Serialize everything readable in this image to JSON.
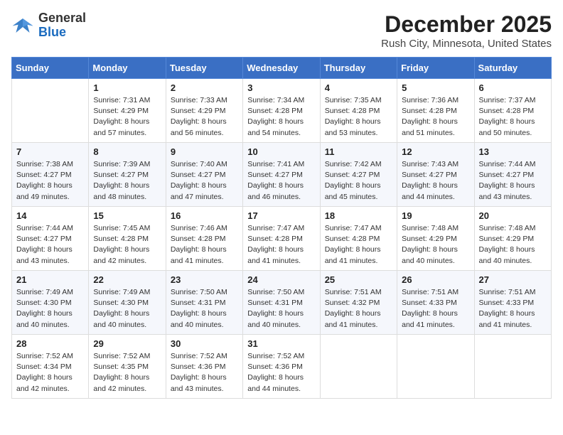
{
  "logo": {
    "general": "General",
    "blue": "Blue"
  },
  "title": "December 2025",
  "subtitle": "Rush City, Minnesota, United States",
  "days_of_week": [
    "Sunday",
    "Monday",
    "Tuesday",
    "Wednesday",
    "Thursday",
    "Friday",
    "Saturday"
  ],
  "weeks": [
    [
      {
        "day": "",
        "info": ""
      },
      {
        "day": "1",
        "info": "Sunrise: 7:31 AM\nSunset: 4:29 PM\nDaylight: 8 hours\nand 57 minutes."
      },
      {
        "day": "2",
        "info": "Sunrise: 7:33 AM\nSunset: 4:29 PM\nDaylight: 8 hours\nand 56 minutes."
      },
      {
        "day": "3",
        "info": "Sunrise: 7:34 AM\nSunset: 4:28 PM\nDaylight: 8 hours\nand 54 minutes."
      },
      {
        "day": "4",
        "info": "Sunrise: 7:35 AM\nSunset: 4:28 PM\nDaylight: 8 hours\nand 53 minutes."
      },
      {
        "day": "5",
        "info": "Sunrise: 7:36 AM\nSunset: 4:28 PM\nDaylight: 8 hours\nand 51 minutes."
      },
      {
        "day": "6",
        "info": "Sunrise: 7:37 AM\nSunset: 4:28 PM\nDaylight: 8 hours\nand 50 minutes."
      }
    ],
    [
      {
        "day": "7",
        "info": "Sunrise: 7:38 AM\nSunset: 4:27 PM\nDaylight: 8 hours\nand 49 minutes."
      },
      {
        "day": "8",
        "info": "Sunrise: 7:39 AM\nSunset: 4:27 PM\nDaylight: 8 hours\nand 48 minutes."
      },
      {
        "day": "9",
        "info": "Sunrise: 7:40 AM\nSunset: 4:27 PM\nDaylight: 8 hours\nand 47 minutes."
      },
      {
        "day": "10",
        "info": "Sunrise: 7:41 AM\nSunset: 4:27 PM\nDaylight: 8 hours\nand 46 minutes."
      },
      {
        "day": "11",
        "info": "Sunrise: 7:42 AM\nSunset: 4:27 PM\nDaylight: 8 hours\nand 45 minutes."
      },
      {
        "day": "12",
        "info": "Sunrise: 7:43 AM\nSunset: 4:27 PM\nDaylight: 8 hours\nand 44 minutes."
      },
      {
        "day": "13",
        "info": "Sunrise: 7:44 AM\nSunset: 4:27 PM\nDaylight: 8 hours\nand 43 minutes."
      }
    ],
    [
      {
        "day": "14",
        "info": "Sunrise: 7:44 AM\nSunset: 4:27 PM\nDaylight: 8 hours\nand 43 minutes."
      },
      {
        "day": "15",
        "info": "Sunrise: 7:45 AM\nSunset: 4:28 PM\nDaylight: 8 hours\nand 42 minutes."
      },
      {
        "day": "16",
        "info": "Sunrise: 7:46 AM\nSunset: 4:28 PM\nDaylight: 8 hours\nand 41 minutes."
      },
      {
        "day": "17",
        "info": "Sunrise: 7:47 AM\nSunset: 4:28 PM\nDaylight: 8 hours\nand 41 minutes."
      },
      {
        "day": "18",
        "info": "Sunrise: 7:47 AM\nSunset: 4:28 PM\nDaylight: 8 hours\nand 41 minutes."
      },
      {
        "day": "19",
        "info": "Sunrise: 7:48 AM\nSunset: 4:29 PM\nDaylight: 8 hours\nand 40 minutes."
      },
      {
        "day": "20",
        "info": "Sunrise: 7:48 AM\nSunset: 4:29 PM\nDaylight: 8 hours\nand 40 minutes."
      }
    ],
    [
      {
        "day": "21",
        "info": "Sunrise: 7:49 AM\nSunset: 4:30 PM\nDaylight: 8 hours\nand 40 minutes."
      },
      {
        "day": "22",
        "info": "Sunrise: 7:49 AM\nSunset: 4:30 PM\nDaylight: 8 hours\nand 40 minutes."
      },
      {
        "day": "23",
        "info": "Sunrise: 7:50 AM\nSunset: 4:31 PM\nDaylight: 8 hours\nand 40 minutes."
      },
      {
        "day": "24",
        "info": "Sunrise: 7:50 AM\nSunset: 4:31 PM\nDaylight: 8 hours\nand 40 minutes."
      },
      {
        "day": "25",
        "info": "Sunrise: 7:51 AM\nSunset: 4:32 PM\nDaylight: 8 hours\nand 41 minutes."
      },
      {
        "day": "26",
        "info": "Sunrise: 7:51 AM\nSunset: 4:33 PM\nDaylight: 8 hours\nand 41 minutes."
      },
      {
        "day": "27",
        "info": "Sunrise: 7:51 AM\nSunset: 4:33 PM\nDaylight: 8 hours\nand 41 minutes."
      }
    ],
    [
      {
        "day": "28",
        "info": "Sunrise: 7:52 AM\nSunset: 4:34 PM\nDaylight: 8 hours\nand 42 minutes."
      },
      {
        "day": "29",
        "info": "Sunrise: 7:52 AM\nSunset: 4:35 PM\nDaylight: 8 hours\nand 42 minutes."
      },
      {
        "day": "30",
        "info": "Sunrise: 7:52 AM\nSunset: 4:36 PM\nDaylight: 8 hours\nand 43 minutes."
      },
      {
        "day": "31",
        "info": "Sunrise: 7:52 AM\nSunset: 4:36 PM\nDaylight: 8 hours\nand 44 minutes."
      },
      {
        "day": "",
        "info": ""
      },
      {
        "day": "",
        "info": ""
      },
      {
        "day": "",
        "info": ""
      }
    ]
  ]
}
